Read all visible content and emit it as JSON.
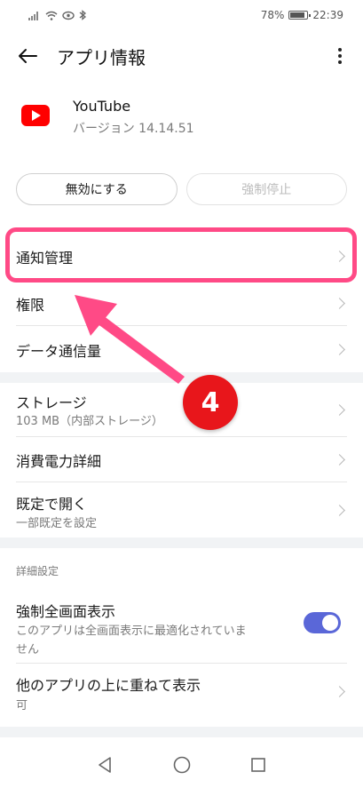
{
  "status_bar": {
    "battery_percent": "78%",
    "time": "22:39"
  },
  "app_bar": {
    "title": "アプリ情報"
  },
  "app": {
    "name": "YouTube",
    "version": "バージョン 14.14.51"
  },
  "buttons": {
    "disable": "無効にする",
    "force_stop": "強制停止"
  },
  "items": {
    "notifications": "通知管理",
    "permissions": "権限",
    "data_usage": "データ通信量",
    "storage": "ストレージ",
    "storage_sub": "103 MB（内部ストレージ）",
    "battery": "消費電力詳細",
    "open_default": "既定で開く",
    "open_default_sub": "一部既定を設定",
    "fullscreen": "強制全画面表示",
    "fullscreen_sub_line1": "このアプリは全画面表示に最適化されていま",
    "fullscreen_sub_line2": "せん",
    "overlay": "他のアプリの上に重ねて表示",
    "overlay_sub": "可"
  },
  "section": {
    "advanced": "詳細設定"
  },
  "annotation": {
    "step_number": "4"
  },
  "toggle": {
    "fullscreen_on": true
  },
  "colors": {
    "highlight": "#ff4a86",
    "badge": "#e8161b",
    "toggle_on": "#5a67d8",
    "youtube_red": "#ff0000"
  }
}
